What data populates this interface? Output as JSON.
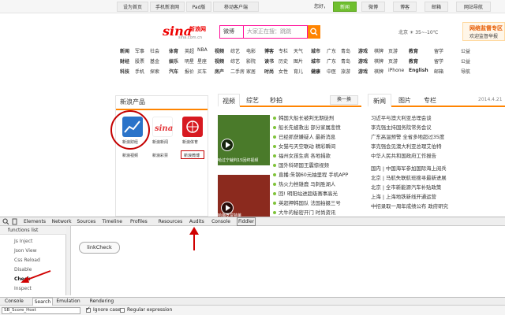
{
  "topbar": {
    "links": [
      "设为首页",
      "手机新浪网",
      "Pad版",
      "移动客户端"
    ],
    "user_text": "您好，",
    "right_links": [
      "新闻",
      "微博",
      "博客",
      "邮箱",
      "网站导航"
    ]
  },
  "logo": {
    "main": "sina",
    "cn": "新浪网",
    "sub": "sina.com.cn"
  },
  "search": {
    "scope": "微博",
    "placeholder": "大家正在搜：跳跳"
  },
  "weather": {
    "text": "北京 ☀ 35~-10℃"
  },
  "ad": {
    "line1": "网络监督专区",
    "line2": "欢迎监督举报"
  },
  "nav": {
    "rows": [
      [
        "新闻",
        "军事",
        "社会",
        "体育",
        "英超",
        "NBA",
        "视频",
        "综艺",
        "电影",
        "博客",
        "专栏",
        "天气",
        "城市",
        "广东",
        "青岛",
        "游戏",
        "棋牌",
        "页游",
        "教育",
        "留学",
        "公益"
      ],
      [
        "财经",
        "股票",
        "基金",
        "娱乐",
        "明星",
        "星座",
        "视频",
        "综艺",
        "影院",
        "读书",
        "历史",
        "图片",
        "城市",
        "广东",
        "青岛",
        "游戏",
        "棋牌",
        "页游",
        "教育",
        "留学",
        "公益"
      ],
      [
        "科技",
        "手机",
        "探索",
        "汽车",
        "报价",
        "买车",
        "房产",
        "二手房",
        "家居",
        "时尚",
        "女性",
        "育儿",
        "健康",
        "中医",
        "旅游",
        "游戏",
        "棋牌",
        "iPhone",
        "English",
        "邮箱",
        "导航"
      ]
    ]
  },
  "left_panel": {
    "title": "新浪产品",
    "apps": [
      {
        "name": "新浪财经",
        "color": "#2a73c9"
      },
      {
        "name": "新浪新闻",
        "color": "#e4393c"
      },
      {
        "name": "新浪体育",
        "color": "#d71920"
      },
      {
        "name": "新浪视频",
        "color": "#2a9be3"
      },
      {
        "name": "新浪彩票",
        "color": "#e86a10"
      },
      {
        "name": "新浪微博",
        "color": "#e6162d"
      }
    ]
  },
  "middle_panel": {
    "tabs": [
      "视频",
      "综艺",
      "秒拍"
    ],
    "swap_label": "换一换",
    "video_captions": [
      "哈过宁裁判15回终视频",
      "哈梅罗贾特莱"
    ],
    "news": [
      "韩国大船长被判无期徒刑",
      "船长先被救出 部分家属悲愤",
      "已经抓获嫌疑人 最新消息",
      "女猫与天空联动 精彩瞬间",
      "福州女孩生病 各地捐款",
      "国外科研国王震惊视频",
      "直播:朱钢60元抽里程  手机APP",
      "热火力挫雄鹿 马刺胜湖人",
      "回! 明阳站进超级赛事高光",
      "英超押韩国队 法国拍摄三号",
      "大牛的秘密开门 时尚资讯"
    ]
  },
  "right_panel": {
    "tabs": [
      "新闻",
      "图片",
      "专栏"
    ],
    "date": "2014.4.21",
    "news": [
      "习近平与澳大利亚总理会谈",
      "李克强主持国务院常务会议",
      "广东高温预警 全省多地超过35度",
      "李克强会见澳大利亚总理艾伯特",
      "中华人民共和国政府工作报告",
      "国内 | 中国海军参加国际海上阅兵",
      "北京 | 马航失联航班搜寻最新进展",
      "北京 | 全市新能源汽车补贴政策",
      "上海 | 上海地铁新线开通运营",
      "中招录取一周年成绩公布  政府研究"
    ]
  },
  "devtools": {
    "tabs": [
      "Elements",
      "Network",
      "Sources",
      "Timeline",
      "Profiles",
      "Resources",
      "Audits",
      "Console",
      "Fiddler"
    ],
    "selected_tab": "Fiddler",
    "functions_header": "functions list",
    "functions": [
      "Js Inject",
      "Json View",
      "Css Reload",
      "Disable",
      "Check",
      "Inspect"
    ],
    "active_function": "Check",
    "main_button": "linkCheck",
    "drawer_tabs": [
      "Console",
      "Search",
      "Emulation",
      "Rendering"
    ],
    "drawer_selected": "Search",
    "filter_value": "SB_Score_Host",
    "ignore_case_label": "Ignore case",
    "ignore_case_checked": true,
    "regex_label": "Regular expression",
    "regex_checked": false
  }
}
